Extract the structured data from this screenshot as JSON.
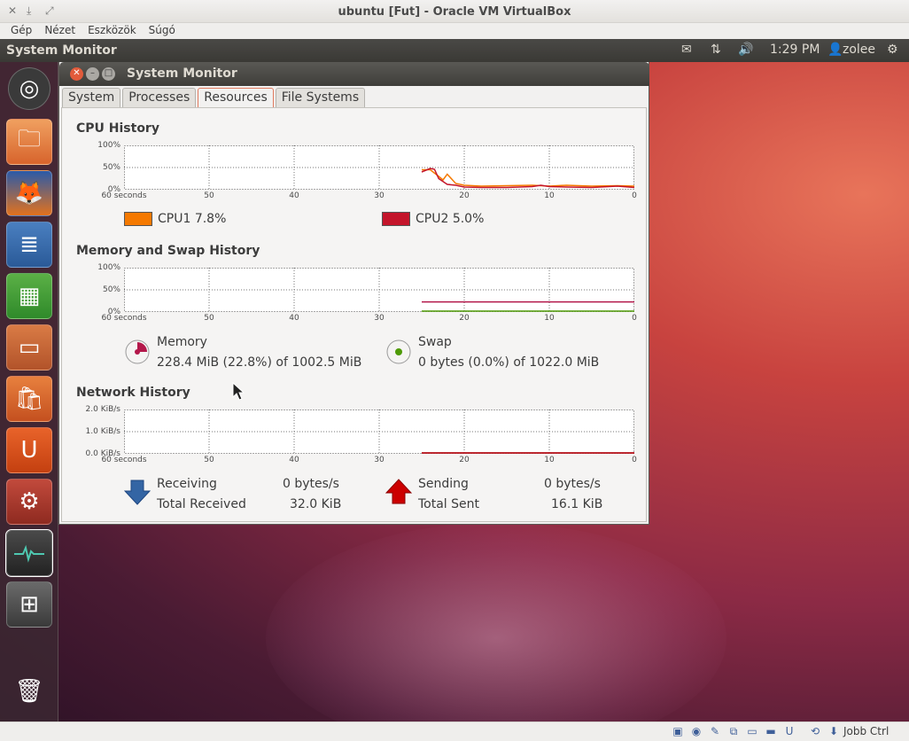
{
  "vbox": {
    "title": "ubuntu [Fut] - Oracle VM VirtualBox",
    "menu": [
      "Gép",
      "Nézet",
      "Eszközök",
      "Súgó"
    ],
    "host_key": "Jobb Ctrl"
  },
  "panel": {
    "app_title": "System Monitor",
    "time": "1:29 PM",
    "user": "zolee"
  },
  "window": {
    "title": "System Monitor",
    "tabs": [
      "System",
      "Processes",
      "Resources",
      "File Systems"
    ],
    "active_tab": "Resources"
  },
  "cpu": {
    "title": "CPU History",
    "cpu1_label": "CPU1",
    "cpu1_value": "7.8%",
    "cpu1_color": "#f57900",
    "cpu2_label": "CPU2",
    "cpu2_value": "5.0%",
    "cpu2_color": "#c4152b"
  },
  "memory": {
    "title": "Memory and Swap History",
    "memory_label": "Memory",
    "memory_value": "228.4 MiB (22.8%) of 1002.5 MiB",
    "memory_color": "#b3174a",
    "swap_label": "Swap",
    "swap_value": "0 bytes (0.0%) of 1022.0 MiB",
    "swap_color": "#4e9a06"
  },
  "network": {
    "title": "Network History",
    "receiving_label": "Receiving",
    "receiving_value": "0 bytes/s",
    "total_received_label": "Total Received",
    "total_received_value": "32.0 KiB",
    "sending_label": "Sending",
    "sending_value": "0 bytes/s",
    "total_sent_label": "Total Sent",
    "total_sent_value": "16.1 KiB",
    "receive_color": "#3465a4",
    "send_color": "#cc0000"
  },
  "chart_data": [
    {
      "type": "line",
      "title": "CPU History",
      "x_ticks": [
        "60 seconds",
        "50",
        "40",
        "30",
        "20",
        "10",
        "0"
      ],
      "y_ticks": [
        "100%",
        "50%",
        "0%"
      ],
      "xlim": [
        60,
        0
      ],
      "ylim": [
        0,
        100
      ],
      "grid": true,
      "series": [
        {
          "name": "CPU1",
          "color": "#f57900",
          "x": [
            25,
            24,
            23,
            22.5,
            22,
            21,
            20,
            18,
            15,
            12,
            10,
            8,
            5,
            2,
            0
          ],
          "y": [
            45,
            45,
            30,
            22,
            35,
            14,
            10,
            8,
            9,
            10,
            8,
            10,
            8,
            9,
            8
          ]
        },
        {
          "name": "CPU2",
          "color": "#c4152b",
          "x": [
            25,
            24,
            23.5,
            23,
            22,
            21,
            20,
            18,
            15,
            12,
            11,
            10,
            8,
            5,
            2,
            0
          ],
          "y": [
            40,
            48,
            46,
            25,
            12,
            10,
            6,
            5,
            5,
            7,
            10,
            7,
            6,
            5,
            8,
            5
          ]
        }
      ]
    },
    {
      "type": "line",
      "title": "Memory and Swap History",
      "x_ticks": [
        "60 seconds",
        "50",
        "40",
        "30",
        "20",
        "10",
        "0"
      ],
      "y_ticks": [
        "100%",
        "50%",
        "0%"
      ],
      "xlim": [
        60,
        0
      ],
      "ylim": [
        0,
        100
      ],
      "grid": true,
      "series": [
        {
          "name": "Memory",
          "color": "#b3174a",
          "x": [
            25,
            0
          ],
          "y": [
            22.8,
            22.8
          ]
        },
        {
          "name": "Swap",
          "color": "#4e9a06",
          "x": [
            25,
            0
          ],
          "y": [
            0,
            0
          ]
        }
      ]
    },
    {
      "type": "line",
      "title": "Network History",
      "x_ticks": [
        "60 seconds",
        "50",
        "40",
        "30",
        "20",
        "10",
        "0"
      ],
      "y_ticks": [
        "2.0 KiB/s",
        "1.0 KiB/s",
        "0.0 KiB/s"
      ],
      "xlim": [
        60,
        0
      ],
      "ylim": [
        0,
        2.0
      ],
      "grid": true,
      "series": [
        {
          "name": "Receiving",
          "color": "#3465a4",
          "x": [
            25,
            0
          ],
          "y": [
            0,
            0
          ]
        },
        {
          "name": "Sending",
          "color": "#cc0000",
          "x": [
            25,
            0
          ],
          "y": [
            0,
            0
          ]
        }
      ]
    }
  ]
}
